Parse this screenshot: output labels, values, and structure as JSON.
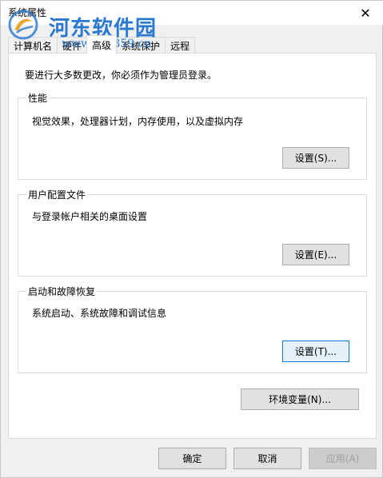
{
  "window": {
    "title": "系统属性",
    "close_glyph": "✕"
  },
  "watermark": {
    "name": "河东软件园",
    "url": "www.pc0359.cn"
  },
  "tabs": [
    {
      "label": "计算机名",
      "active": false
    },
    {
      "label": "硬件",
      "active": false
    },
    {
      "label": "高级",
      "active": true
    },
    {
      "label": "系统保护",
      "active": false
    },
    {
      "label": "远程",
      "active": false
    }
  ],
  "intro": "要进行大多数更改，你必须作为管理员登录。",
  "performance": {
    "label": "性能",
    "desc": "视觉效果，处理器计划，内存使用，以及虚拟内存",
    "button": "设置(S)..."
  },
  "user_profiles": {
    "label": "用户配置文件",
    "desc": "与登录帐户相关的桌面设置",
    "button": "设置(E)..."
  },
  "startup_recovery": {
    "label": "启动和故障恢复",
    "desc": "系统启动、系统故障和调试信息",
    "button": "设置(T)..."
  },
  "env_button": "环境变量(N)...",
  "footer": {
    "ok": "确定",
    "cancel": "取消",
    "apply": "应用(A)"
  },
  "colors": {
    "focus_border": "#0078d7",
    "watermark": "#2a78d0"
  }
}
